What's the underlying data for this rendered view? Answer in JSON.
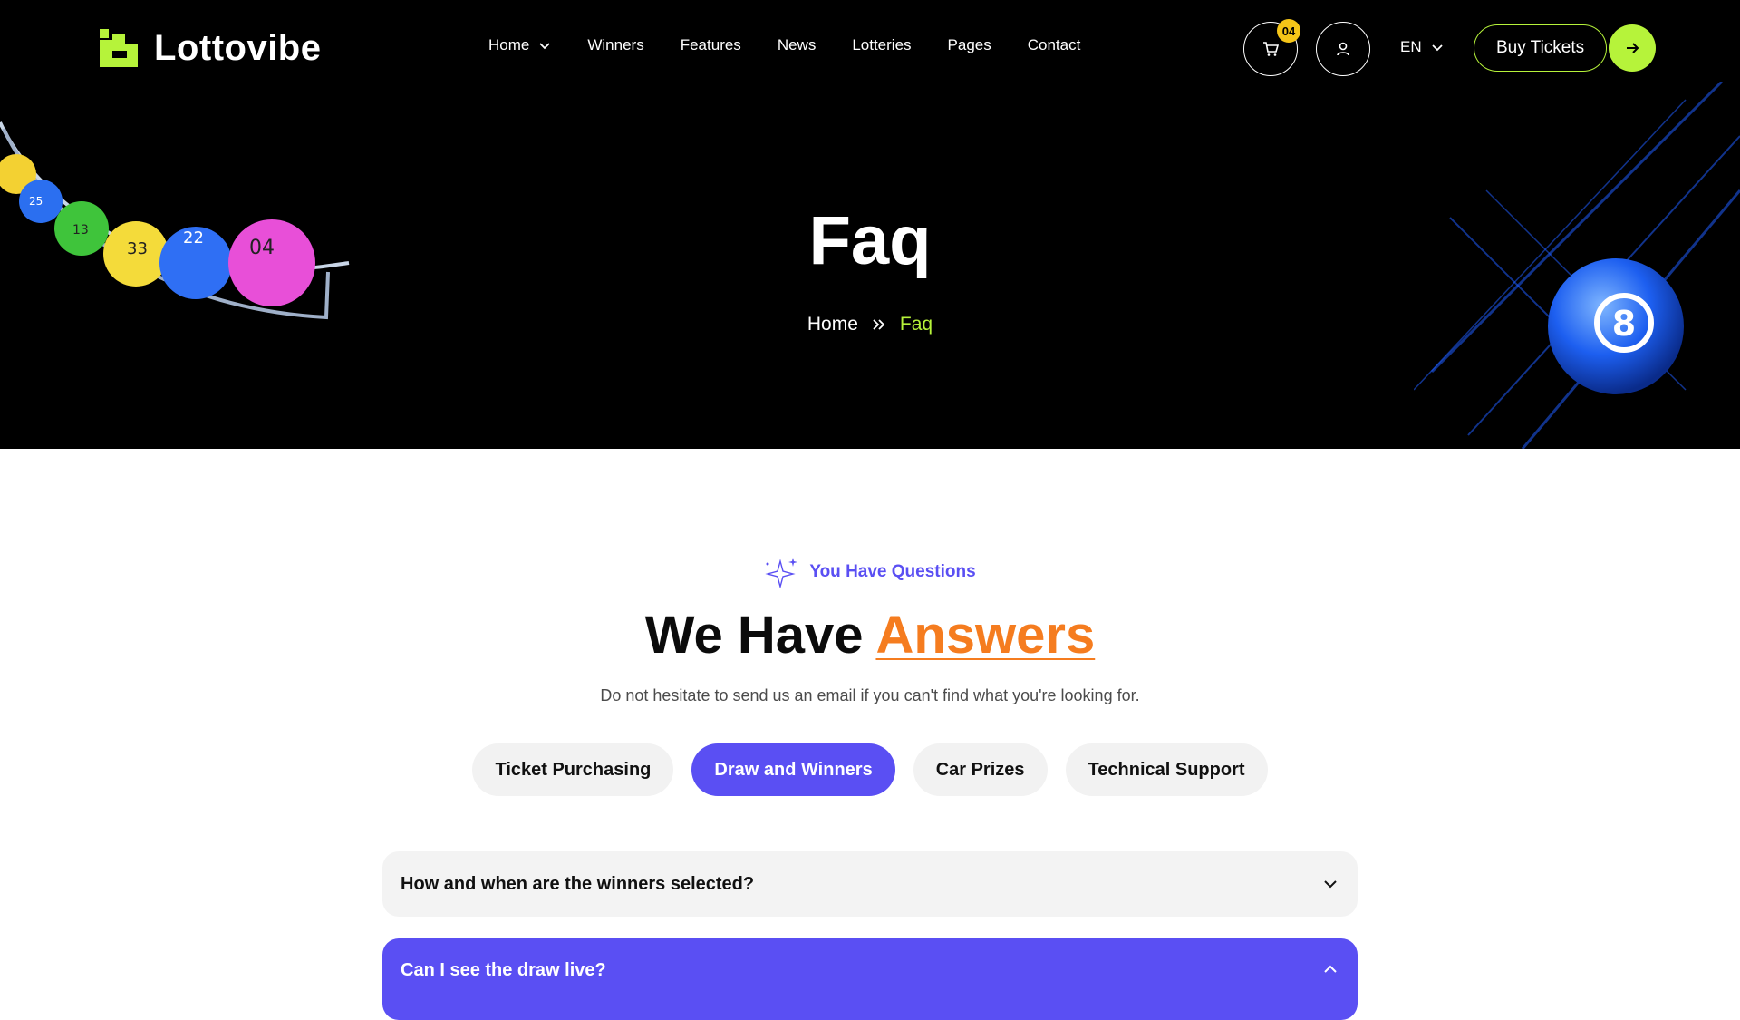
{
  "brand": {
    "name": "Lottovibe",
    "accent": "#b6f33a"
  },
  "nav": {
    "items": [
      {
        "label": "Home",
        "has_dropdown": true
      },
      {
        "label": "Winners"
      },
      {
        "label": "Features"
      },
      {
        "label": "News"
      },
      {
        "label": "Lotteries"
      },
      {
        "label": "Pages"
      },
      {
        "label": "Contact"
      }
    ]
  },
  "header": {
    "cart_count": "04",
    "cart_icon": "cart-icon",
    "user_icon": "user-icon",
    "language": "EN",
    "buy_label": "Buy Tickets"
  },
  "hero": {
    "title": "Faq",
    "breadcrumb": {
      "home": "Home",
      "current": "Faq"
    },
    "ball_number": "8"
  },
  "faq_section": {
    "eyebrow": "You Have Questions",
    "headline_plain": "We Have",
    "headline_accent": "Answers",
    "subtext": "Do not hesitate to send us an email if you can't find what you're looking for.",
    "tabs": [
      {
        "label": "Ticket Purchasing",
        "active": false
      },
      {
        "label": "Draw and Winners",
        "active": true
      },
      {
        "label": "Car Prizes",
        "active": false
      },
      {
        "label": "Technical Support",
        "active": false
      }
    ],
    "questions": [
      {
        "q": "How and when are the winners selected?",
        "open": false
      },
      {
        "q": "Can I see the draw live?",
        "open": true
      }
    ],
    "accent_purple": "#5a4ff3",
    "accent_orange": "#f57c1f"
  }
}
